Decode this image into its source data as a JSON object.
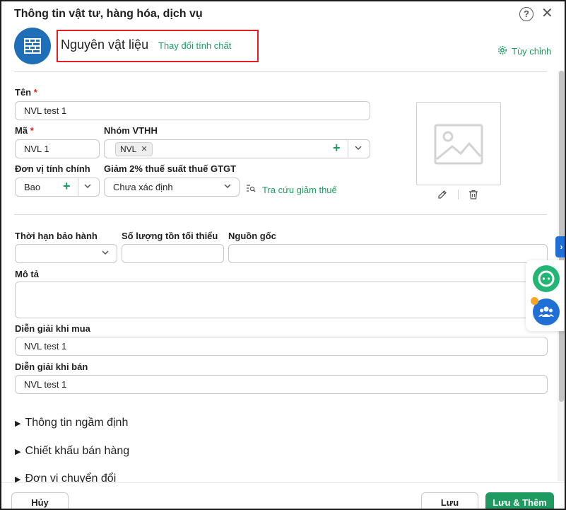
{
  "header": {
    "title": "Thông tin vật tư, hàng hóa, dịch vụ",
    "help_icon": "question-circle-icon",
    "close_icon": "close-icon"
  },
  "type_block": {
    "avatar_icon": "brick-wall-icon",
    "name": "Nguyên vật liệu",
    "change_label": "Thay đổi tính chất",
    "customize_label": "Tùy chỉnh"
  },
  "fields": {
    "ten": {
      "label": "Tên",
      "value": "NVL test 1"
    },
    "ma": {
      "label": "Mã",
      "value": "NVL 1"
    },
    "nhom_vthh": {
      "label": "Nhóm VTHH",
      "tag": "NVL"
    },
    "don_vi": {
      "label": "Đơn vị tính chính",
      "value": "Bao"
    },
    "giam_thue": {
      "label": "Giảm 2% thuế suất thuế GTGT",
      "value": "Chưa xác định",
      "lookup_label": "Tra cứu giảm thuế"
    },
    "thoi_han": {
      "label": "Thời hạn bảo hành",
      "value": ""
    },
    "so_luong": {
      "label": "Số lượng tồn tối thiểu",
      "value": ""
    },
    "nguon_goc": {
      "label": "Nguồn gốc",
      "value": ""
    },
    "mo_ta": {
      "label": "Mô tả",
      "value": ""
    },
    "dien_giai_mua": {
      "label": "Diễn giải khi mua",
      "value": "NVL test 1"
    },
    "dien_giai_ban": {
      "label": "Diễn giải khi bán",
      "value": "NVL test 1"
    },
    "required_mark": "*"
  },
  "sections": [
    {
      "label": "Thông tin ngầm định"
    },
    {
      "label": "Chiết khấu bán hàng"
    },
    {
      "label": "Đơn vị chuyển đổi"
    }
  ],
  "footer": {
    "cancel_label": "Hủy",
    "save_label": "Lưu",
    "save_add_label": "Lưu & Thêm"
  },
  "colors": {
    "accent_green": "#1f9b62",
    "brand_blue": "#1f6fb8",
    "highlight_red": "#e02020"
  }
}
